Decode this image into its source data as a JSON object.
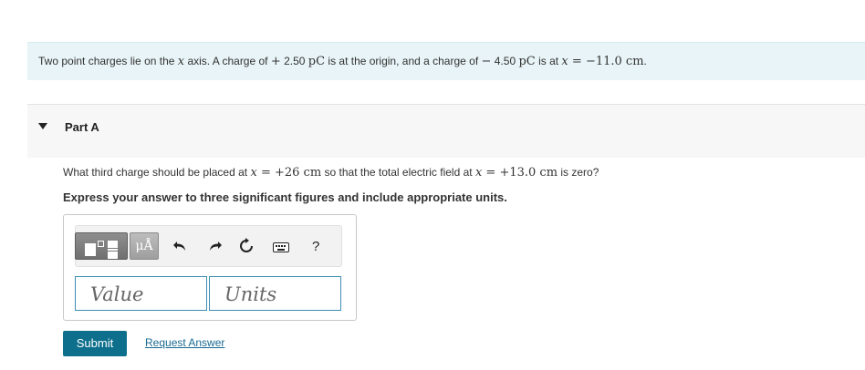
{
  "problem": {
    "pre1": "Two point charges lie on the ",
    "var_x": "x",
    "pre2": " axis. A charge of ",
    "q1_sign": "+",
    "q1_value": " 2.50 ",
    "q1_unit": "pC",
    "mid": " is at the origin, and a charge of ",
    "q2_sign": "−",
    "q2_value": " 4.50 ",
    "q2_unit": "pC",
    "post": " is at ",
    "eq": " = ",
    "pos_value": "−11.0 cm",
    "end": "."
  },
  "part": {
    "title": "Part A"
  },
  "question": {
    "pre": "What third charge should be placed at ",
    "var_x": "x",
    "eq": " = ",
    "place": "+26 cm",
    "mid": " so that the total electric field at ",
    "var_x2": "x",
    "eq2": " = ",
    "point": "+13.0 cm",
    "post": " is zero?"
  },
  "instruction": "Express your answer to three significant figures and include appropriate units.",
  "toolbar": {
    "units_label": "μÅ",
    "undo_icon": "undo-icon",
    "redo_icon": "redo-icon",
    "reset_icon": "reset-icon",
    "keyboard_icon": "keyboard-icon",
    "help_label": "?"
  },
  "inputs": {
    "value_placeholder": "Value",
    "units_placeholder": "Units"
  },
  "actions": {
    "submit_label": "Submit",
    "request_label": "Request Answer"
  },
  "colors": {
    "problem_bg": "#e8f4f7",
    "submit_bg": "#0d6f8c",
    "input_border": "#3d8db0",
    "link": "#1a6a92"
  }
}
